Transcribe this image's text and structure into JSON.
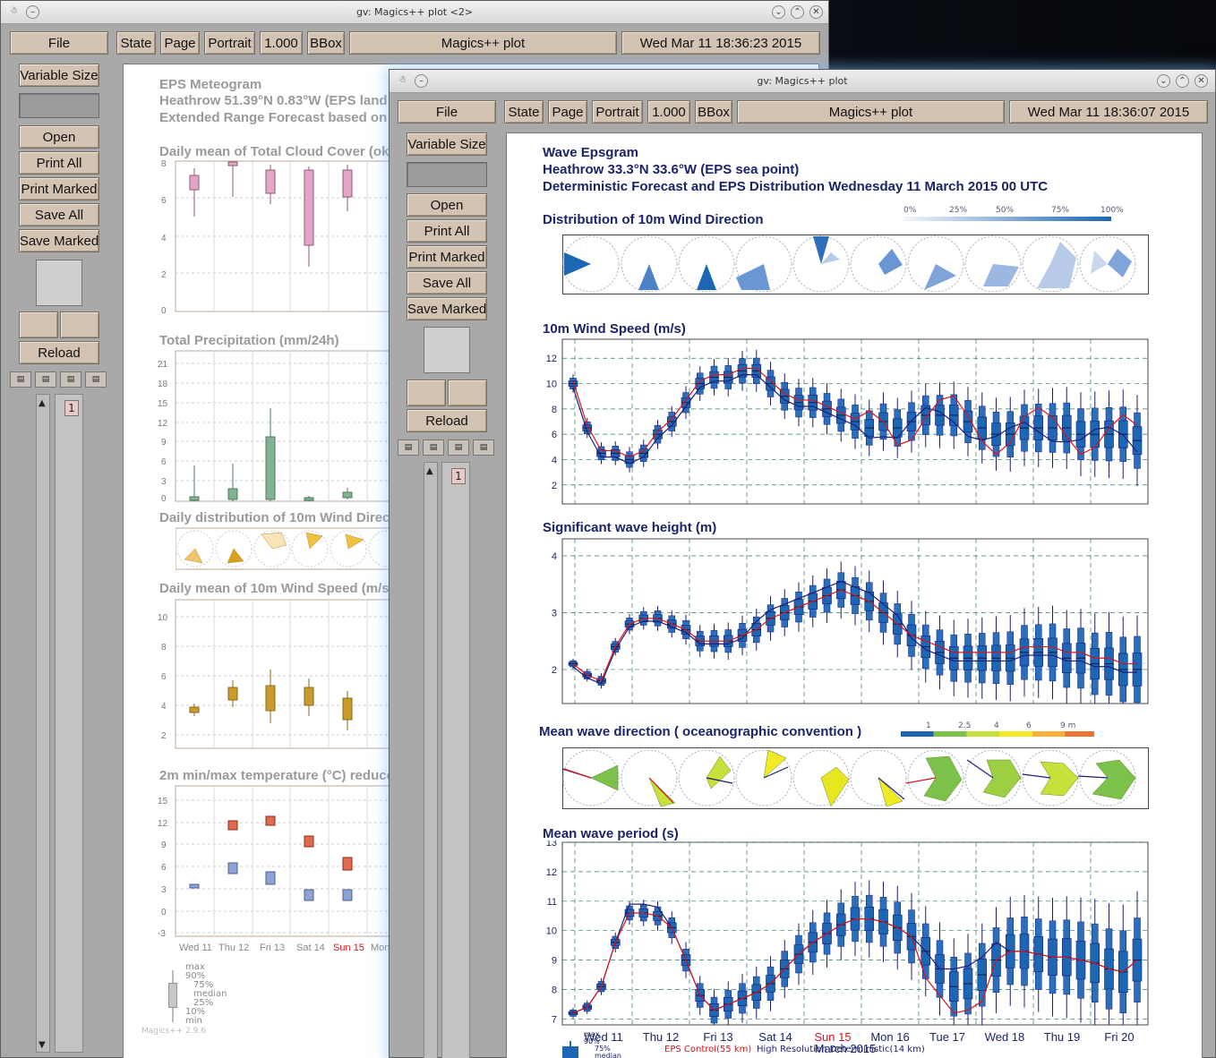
{
  "back_window": {
    "title": "gv: Magics++ plot <2>",
    "toolbar": {
      "file": "File",
      "state": "State",
      "page": "Page",
      "orientation": "Portrait",
      "scale": "1.000",
      "bbox": "BBox",
      "doc_title": "Magics++ plot",
      "date": "Wed Mar 11 18:36:23 2015"
    },
    "side": {
      "variable_size": "Variable Size",
      "open": "Open",
      "print_all": "Print All",
      "print_marked": "Print Marked",
      "save_all": "Save All",
      "save_marked": "Save Marked",
      "reload": "Reload",
      "page_number": "1"
    },
    "plot": {
      "title_lines": [
        "EPS Meteogram",
        "Heathrow 51.39°N 0.83°W (EPS land p",
        "Extended Range Forecast based on E"
      ],
      "panels": [
        "Daily mean of Total Cloud Cover (okt",
        "Total Precipitation (mm/24h)",
        "Daily distribution of 10m Wind Direct",
        "Daily mean of 10m Wind Speed (m/s)",
        "2m min/max temperature (°C) reduced"
      ],
      "cloud_ticks": [
        "8",
        "6",
        "4",
        "2",
        "0"
      ],
      "precip_ticks": [
        "21",
        "18",
        "15",
        "12",
        "9",
        "6",
        "3",
        "0"
      ],
      "wind_ticks": [
        "10",
        "8",
        "6",
        "4",
        "2"
      ],
      "temp_ticks": [
        "15",
        "12",
        "9",
        "6",
        "3",
        "0",
        "-3"
      ],
      "days": [
        "Wed 11",
        "Thu 12",
        "Fri 13",
        "Sat 14",
        "Sun 15",
        "Mon"
      ],
      "legend": [
        "max",
        "90%",
        "75%",
        "median",
        "25%",
        "10%",
        "min"
      ],
      "version": "Magics++ 2.9.6"
    }
  },
  "front_window": {
    "title": "gv: Magics++ plot",
    "toolbar": {
      "file": "File",
      "state": "State",
      "page": "Page",
      "orientation": "Portrait",
      "scale": "1.000",
      "bbox": "BBox",
      "doc_title": "Magics++ plot",
      "date": "Wed Mar 11 18:36:07 2015"
    },
    "side": {
      "variable_size": "Variable Size",
      "open": "Open",
      "print_all": "Print All",
      "print_marked": "Print Marked",
      "save_all": "Save All",
      "save_marked": "Save Marked",
      "reload": "Reload",
      "page_number": "1"
    },
    "plot": {
      "title_lines": [
        "Wave Epsgram",
        "Heathrow 33.3°N 33.6°W (EPS sea point)",
        "Deterministic Forecast and EPS Distribution Wednesday 11 March 2015 00 UTC"
      ],
      "wind_dir_title": "Distribution of 10m Wind Direction",
      "wind_dir_scale": [
        "0%",
        "25%",
        "50%",
        "75%",
        "100%"
      ],
      "wind_speed_title": "10m Wind Speed (m/s)",
      "wind_speed_ticks": [
        "12",
        "10",
        "8",
        "6",
        "4",
        "2"
      ],
      "wave_height_title": "Significant wave height (m)",
      "wave_height_ticks": [
        "4",
        "3",
        "2"
      ],
      "wave_dir_title": "Mean wave direction ( oceanographic convention )",
      "wave_dir_scale": [
        "1",
        "2.5",
        "4",
        "6",
        "9 m"
      ],
      "wave_period_title": "Mean wave period (s)",
      "wave_period_ticks": [
        "13",
        "12",
        "11",
        "10",
        "9",
        "8",
        "7"
      ],
      "days": [
        "Wed 11",
        "Thu 12",
        "Fri 13",
        "Sat 14",
        "Sun 15",
        "Mon 16",
        "Tue 17",
        "Wed 18",
        "Thu 19",
        "Fri 20"
      ],
      "month_label": "March 2015",
      "legend_box": [
        "max",
        "90%",
        "75%",
        "median"
      ],
      "legend_eps": "EPS Control(55 km)",
      "legend_hres": "High Resolution Deterministic(14 km)",
      "colors": {
        "eps": "#d8141c",
        "hres": "#1d1d74",
        "box": "#1c66b4",
        "sunday": "#d8141c"
      }
    }
  }
}
